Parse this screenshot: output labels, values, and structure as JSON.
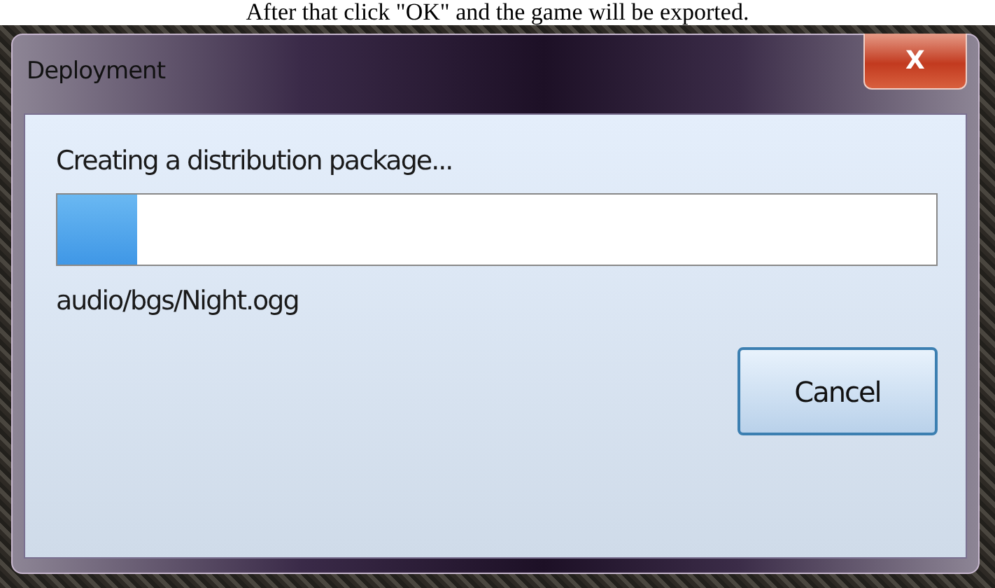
{
  "caption": "After that click \"OK\" and the game will be exported.",
  "window": {
    "title": "Deployment",
    "close_label": "X"
  },
  "status": "Creating a distribution package...",
  "progress": {
    "level": 0.09
  },
  "current_file": "audio/bgs/Night.ogg",
  "buttons": [
    "Cancel"
  ]
}
